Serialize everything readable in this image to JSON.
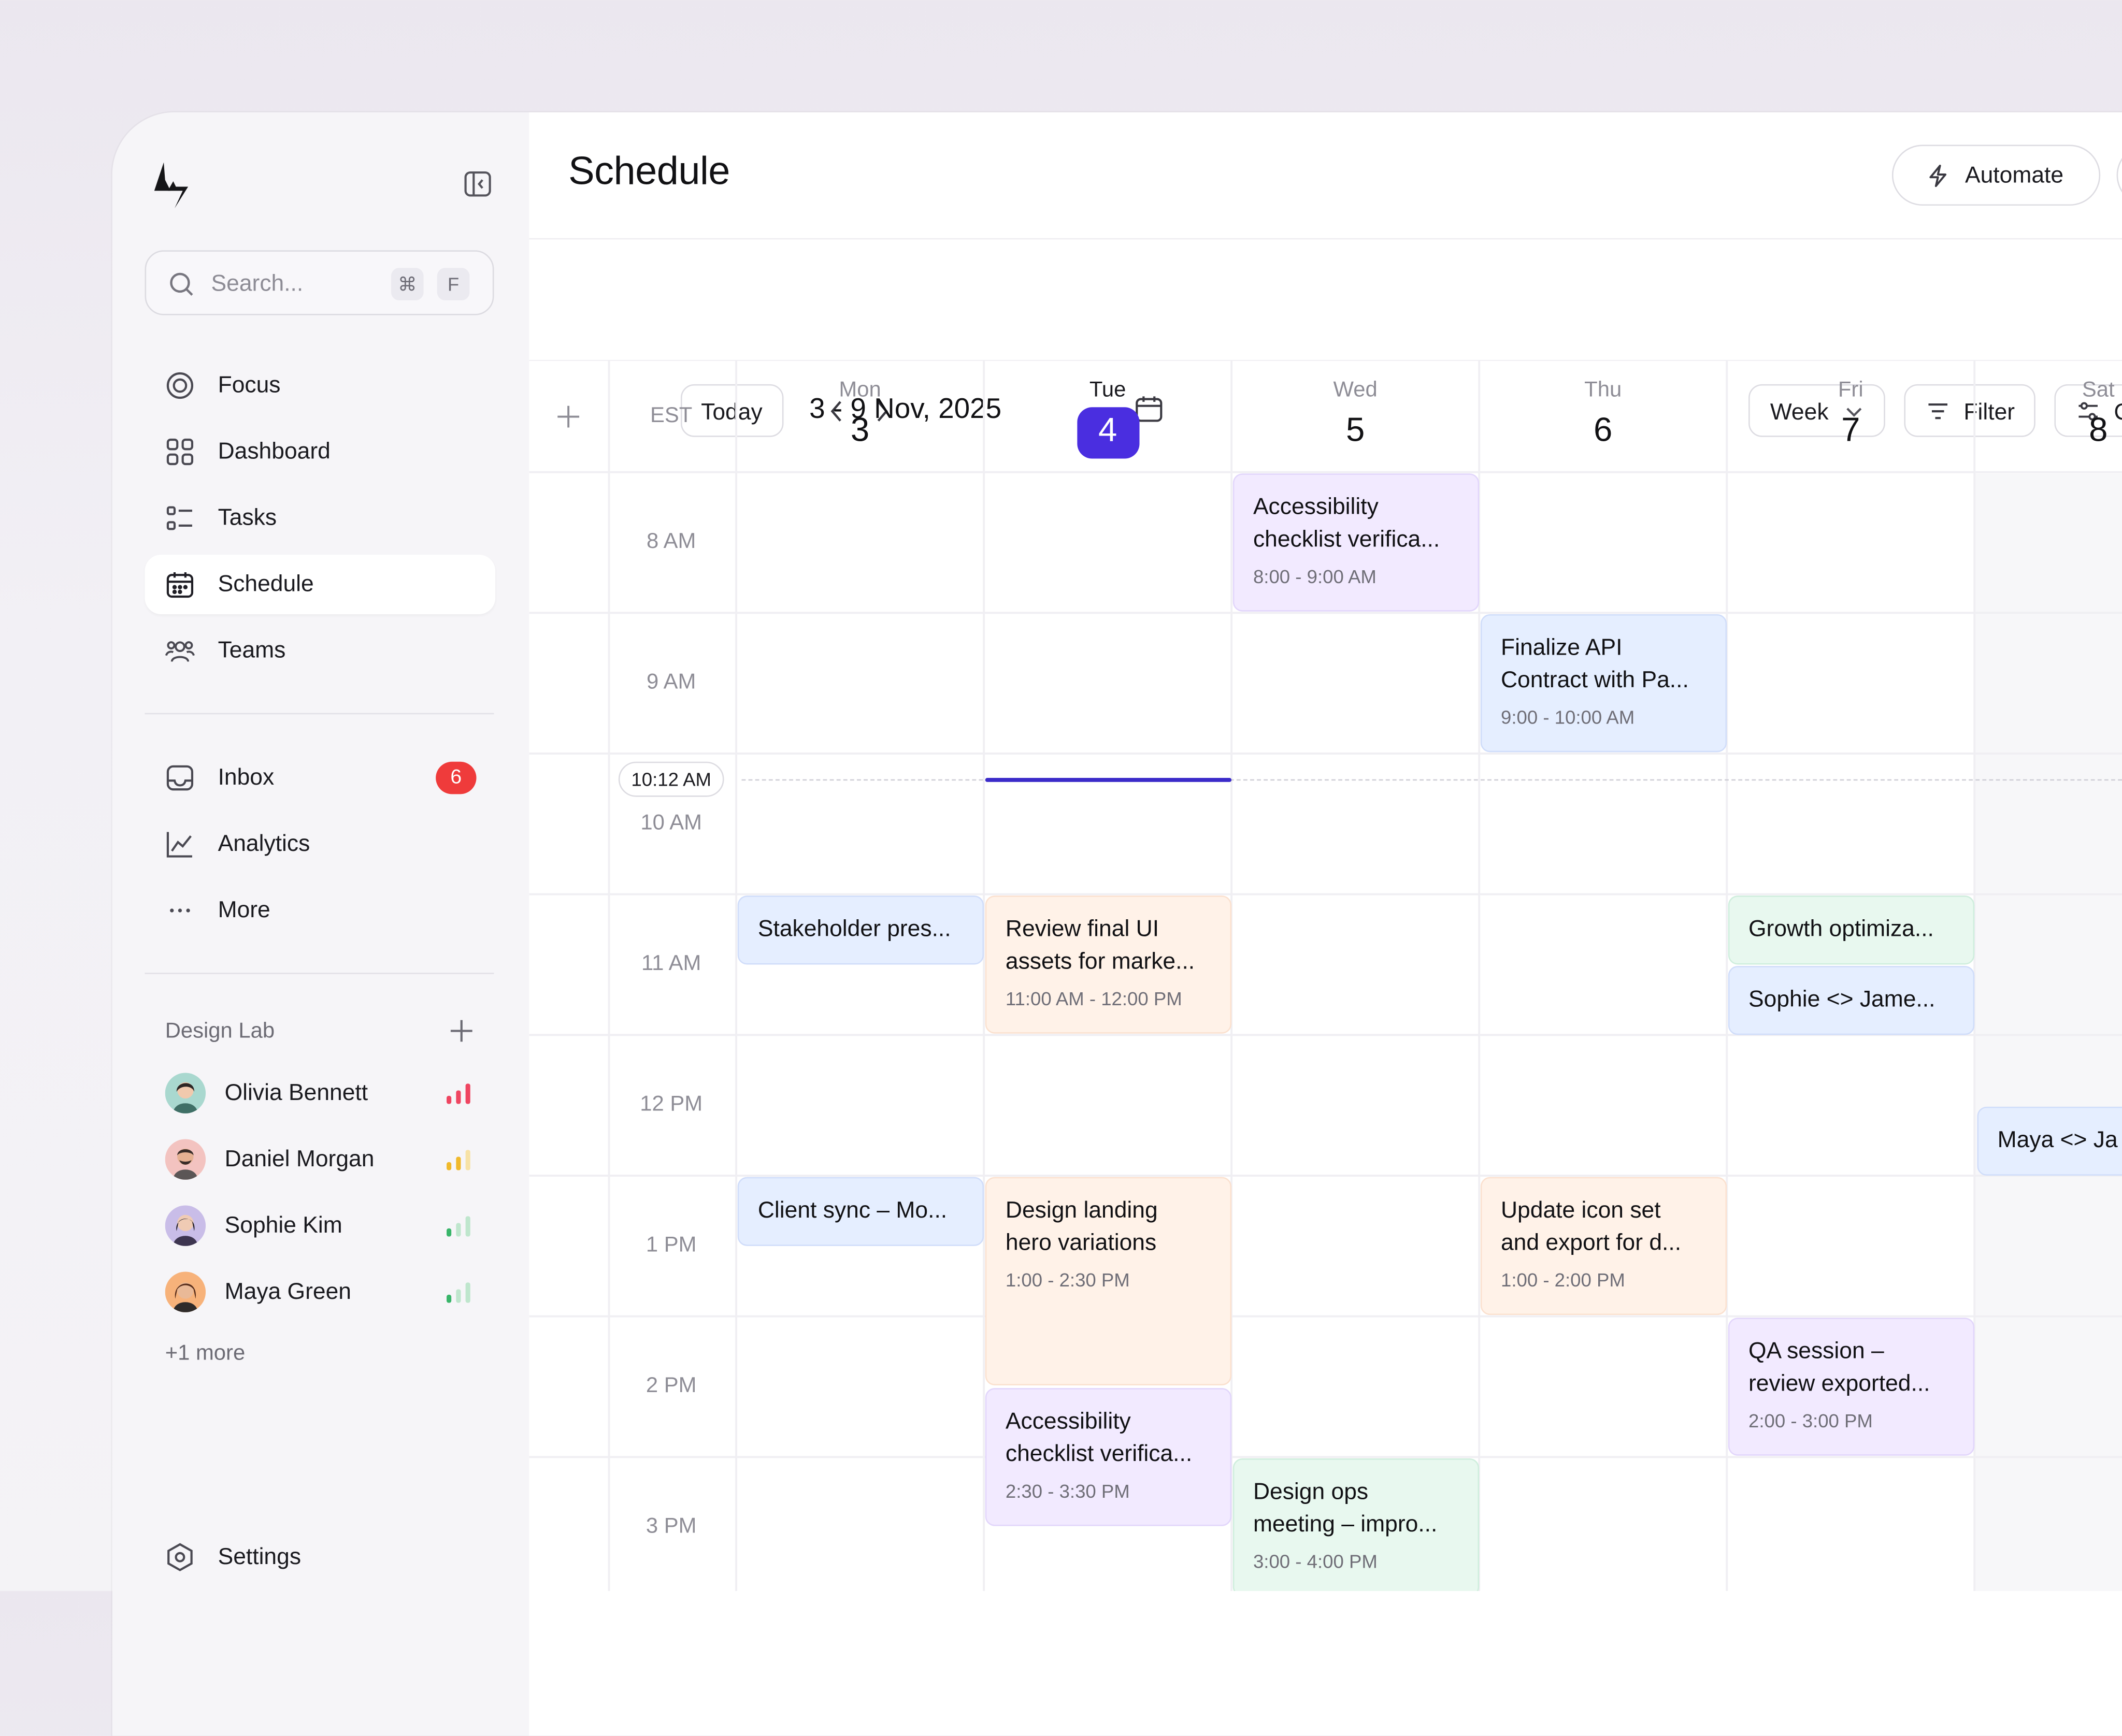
{
  "sidebar": {
    "search": {
      "placeholder": "Search...",
      "shortcut_keys": [
        "⌘",
        "F"
      ]
    },
    "nav": [
      {
        "label": "Focus",
        "icon": "focus-icon"
      },
      {
        "label": "Dashboard",
        "icon": "dashboard-icon"
      },
      {
        "label": "Tasks",
        "icon": "tasks-icon"
      },
      {
        "label": "Schedule",
        "icon": "calendar-icon",
        "active": true
      },
      {
        "label": "Teams",
        "icon": "team-icon"
      }
    ],
    "nav2": [
      {
        "label": "Inbox",
        "icon": "inbox-icon",
        "badge": "6"
      },
      {
        "label": "Analytics",
        "icon": "analytics-icon"
      },
      {
        "label": "More",
        "icon": "more-dots-icon"
      }
    ],
    "section": {
      "title": "Design Lab",
      "members": [
        {
          "name": "Olivia Bennett",
          "signal": 3,
          "signal_color": "#ef4561"
        },
        {
          "name": "Daniel Morgan",
          "signal": 2,
          "signal_color": "#f0b92c"
        },
        {
          "name": "Sophie Kim",
          "signal": 1,
          "signal_color": "#39b56a"
        },
        {
          "name": "Maya Green",
          "signal": 1,
          "signal_color": "#39b56a"
        }
      ],
      "more": "+1 more"
    },
    "settings_label": "Settings"
  },
  "header": {
    "title": "Schedule",
    "automate_label": "Automate"
  },
  "toolbar": {
    "today_label": "Today",
    "date_range": "3 - 9 Nov, 2025",
    "view_label": "Week",
    "filter_label": "Filter",
    "customize_label": "Customize"
  },
  "calendar": {
    "timezone": "EST",
    "days": [
      {
        "name": "Mon",
        "num": "3"
      },
      {
        "name": "Tue",
        "num": "4",
        "today": true
      },
      {
        "name": "Wed",
        "num": "5"
      },
      {
        "name": "Thu",
        "num": "6"
      },
      {
        "name": "Fri",
        "num": "7"
      },
      {
        "name": "Sat",
        "num": "8"
      }
    ],
    "hours": [
      "8 AM",
      "9 AM",
      "10 AM",
      "11 AM",
      "12 PM",
      "1 PM",
      "2 PM",
      "3 PM"
    ],
    "now_label": "10:12 AM",
    "events": [
      {
        "title": "Accessibility\nchecklist verifica...",
        "time": "8:00 - 9:00 AM",
        "color": "purple"
      },
      {
        "title": "Finalize API\nContract with Pa...",
        "time": "9:00 - 10:00 AM",
        "color": "blue"
      },
      {
        "title": "Stakeholder pres...",
        "time": "",
        "color": "blue"
      },
      {
        "title": "Review final UI\nassets for marke...",
        "time": "11:00 AM - 12:00 PM",
        "color": "orange"
      },
      {
        "title": "Growth optimiza...",
        "time": "",
        "color": "green"
      },
      {
        "title": "Sophie <> Jame...",
        "time": "",
        "color": "blue"
      },
      {
        "title": "Maya <> Ja",
        "time": "",
        "color": "blue"
      },
      {
        "title": "Client sync – Mo...",
        "time": "",
        "color": "blue"
      },
      {
        "title": "Design landing\nhero variations",
        "time": "1:00 - 2:30 PM",
        "color": "orange"
      },
      {
        "title": "Update icon set\nand export for d...",
        "time": "1:00 - 2:00 PM",
        "color": "orange"
      },
      {
        "title": "Accessibility\nchecklist verifica...",
        "time": "2:30 - 3:30 PM",
        "color": "purple"
      },
      {
        "title": "QA session –\nreview exported...",
        "time": "2:00 - 3:00 PM",
        "color": "purple"
      },
      {
        "title": "Design ops\nmeeting – impro...",
        "time": "3:00 - 4:00 PM",
        "color": "green"
      }
    ]
  }
}
